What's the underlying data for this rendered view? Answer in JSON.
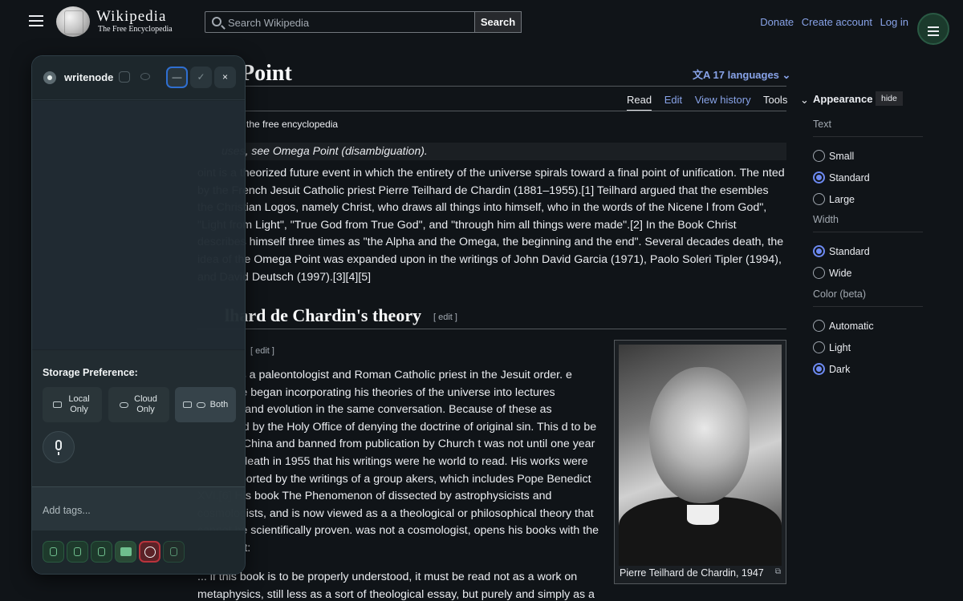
{
  "header": {
    "wordmark": "Wikipedia",
    "tagline": "The Free Encyclopedia",
    "search_placeholder": "Search Wikipedia",
    "search_button": "Search",
    "links": [
      "Donate",
      "Create account",
      "Log in"
    ]
  },
  "article": {
    "title": "Point",
    "languages": "17 languages",
    "tabs": [
      "Read",
      "Edit",
      "View history",
      "Tools"
    ],
    "from": "the free encyclopedia",
    "hatnote": "uses, see Omega Point (disambiguation).",
    "p1": "oint is a theorized future event in which the entirety of the universe spirals toward a final point of unification. The nted by the French Jesuit Catholic priest Pierre Teilhard de Chardin (1881–1955).[1] Teilhard argued that the esembles the Christian Logos, namely Christ, who draws all things into himself, who in the words of the Nicene l from God\", \"Light from Light\", \"True God from True God\", and \"through him all things were made\".[2] In the Book Christ describes himself three times as \"the Alpha and the Omega, the beginning and the end\". Several decades death, the idea of the Omega Point was expanded upon in the writings of John David Garcia (1971), Paolo Soleri Tipler (1994), and David Deutsch (1997).[3][4][5]",
    "h2": "lhard de Chardin's theory",
    "edit_label": "[ edit ]",
    "p2": "ardin was a paleontologist and Roman Catholic priest in the Jesuit order. e 1920s, he began incorporating his theories of the universe into lectures tholicism and evolution in the same conversation. Because of these as suspected by the Holy Office of denying the doctrine of original sin. This d to be exiled to China and banned from publication by Church t was not until one year after his death in 1955 that his writings were he world to read. His works were also supported by the writings of a group akers, which includes Pope Benedict XVI.[6] His book The Phenomenon of dissected by astrophysicists and cosmologists, and is now viewed as a a theological or philosophical theory that cannot be scientifically proven. was not a cosmologist, opens his books with the statement:",
    "p3": "... if this book is to be properly understood, it must be read not as a work on metaphysics, still less as a sort of theological essay, but purely and simply as a",
    "image_caption": "Pierre Teilhard de Chardin, 1947"
  },
  "appearance": {
    "heading": "Appearance",
    "hide": "hide",
    "text_label": "Text",
    "text_options": [
      "Small",
      "Standard",
      "Large"
    ],
    "width_label": "Width",
    "width_options": [
      "Standard",
      "Wide"
    ],
    "color_label": "Color (beta)",
    "color_options": [
      "Automatic",
      "Light",
      "Dark"
    ]
  },
  "writenode": {
    "name": "writenode",
    "min": "—",
    "check": "✓",
    "close": "×",
    "storage_label": "Storage Preference:",
    "storage_local": "Local Only",
    "storage_cloud": "Cloud Only",
    "storage_both": "Both",
    "tags_placeholder": "Add tags..."
  },
  "colors": {
    "link": "#88a3e8",
    "background": "#101418",
    "accent_green": "#1b3a2c",
    "globe_active": "#b8333c"
  }
}
